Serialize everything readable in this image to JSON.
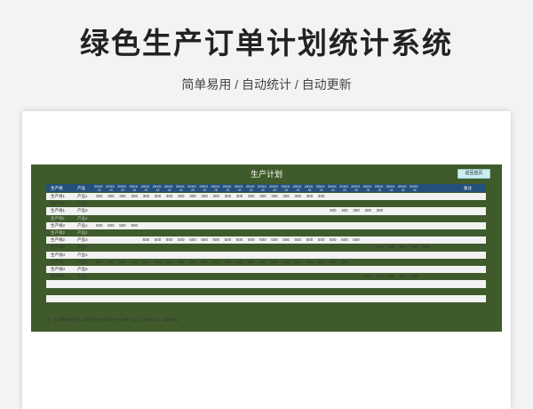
{
  "page": {
    "title": "绿色生产订单计划统计系统",
    "subtitle": "简单易用 / 自动统计 / 自动更新"
  },
  "panel": {
    "title": "生产计划",
    "home_button": "返回首页"
  },
  "table": {
    "headers": {
      "line": "生产线",
      "product": "产品",
      "date_text": "20XX",
      "date_sub": "/X",
      "remark": "备注"
    },
    "rows": [
      {
        "line": "生产线1",
        "product": "产品1",
        "start": 0,
        "values": [
          "300",
          "300",
          "300",
          "300",
          "300",
          "300",
          "300",
          "300",
          "300",
          "300",
          "300",
          "300",
          "300",
          "300",
          "300",
          "300",
          "300",
          "300",
          "300",
          "300"
        ],
        "muted": false
      },
      {
        "line": "生产线1",
        "product": "产品2",
        "start": 0,
        "values": [],
        "muted": false
      },
      {
        "line": "生产线1",
        "product": "产品3",
        "start": 20,
        "values": [
          "300",
          "300",
          "300",
          "300",
          "300"
        ],
        "muted": false
      },
      {
        "line": "生产线1",
        "product": "产品4",
        "start": 0,
        "values": [],
        "muted": true
      },
      {
        "line": "生产线2",
        "product": "产品1",
        "start": 0,
        "values": [
          "500",
          "500",
          "500",
          "500"
        ],
        "muted": false
      },
      {
        "line": "生产线2",
        "product": "产品2",
        "start": 0,
        "values": [],
        "muted": true
      },
      {
        "line": "生产线2",
        "product": "产品3",
        "start": 4,
        "values": [
          "500",
          "500",
          "500",
          "500",
          "500",
          "500",
          "500",
          "500",
          "500",
          "500",
          "500",
          "500",
          "500",
          "500",
          "500",
          "500",
          "500",
          "500",
          "500"
        ],
        "muted": false
      },
      {
        "line": "生产线2",
        "product": "产品4",
        "start": 24,
        "values": [
          "500",
          "500",
          "500",
          "500",
          "500"
        ],
        "muted": false
      },
      {
        "line": "生产线3",
        "product": "产品1",
        "start": 0,
        "values": [],
        "muted": false
      },
      {
        "line": "生产线3",
        "product": "产品2",
        "start": 0,
        "values": [
          "600",
          "600",
          "600",
          "600",
          "600",
          "600",
          "600",
          "600",
          "600",
          "600",
          "600",
          "600",
          "600",
          "600",
          "600",
          "600",
          "600",
          "600",
          "600",
          "600",
          "600",
          "600"
        ],
        "muted": false
      },
      {
        "line": "生产线3",
        "product": "产品3",
        "start": 0,
        "values": [],
        "muted": false
      },
      {
        "line": "生产线3",
        "product": "产品4",
        "start": 23,
        "values": [
          "600",
          "600",
          "600",
          "600",
          "600"
        ],
        "muted": false
      },
      {
        "line": "",
        "product": "",
        "start": 0,
        "values": [],
        "muted": false
      },
      {
        "line": "",
        "product": "",
        "start": 0,
        "values": [],
        "muted": false
      },
      {
        "line": "",
        "product": "",
        "start": 0,
        "values": [],
        "muted": false
      },
      {
        "line": "",
        "product": "",
        "start": 0,
        "values": [],
        "muted": false
      }
    ]
  },
  "note": "注：标注删除线的行，表示该生产线无法生产该种产品。A1列有公式，请勿删除。"
}
